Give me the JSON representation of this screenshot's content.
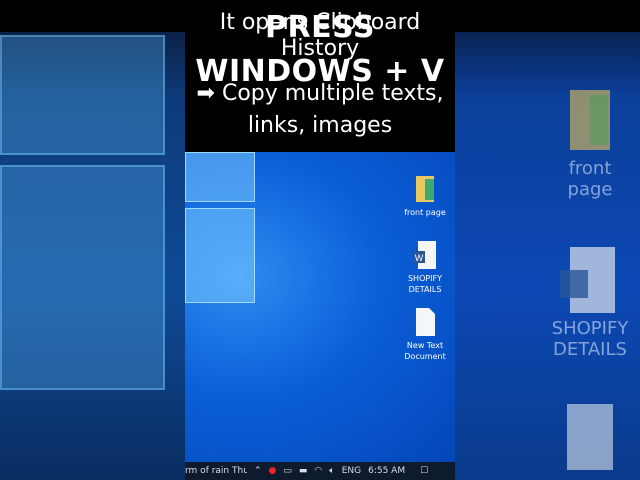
{
  "caption": {
    "headline": "PRESS WINDOWS + V",
    "subtitle": "It opens Clipboard History",
    "bullet_arrow": "➡",
    "bullet": "Copy multiple texts, links, images"
  },
  "desktop": {
    "icons": [
      {
        "label": "front page",
        "icon": "folder-icon"
      },
      {
        "label": "SHOPIFY DETAILS",
        "icon": "word-document-icon"
      },
      {
        "label": "New Text Document",
        "icon": "text-document-icon"
      }
    ]
  },
  "taskbar": {
    "weather": "rm of rain Thu",
    "language": "ENG",
    "time": "6:55 AM"
  },
  "colors": {
    "desktop": "#0b5fd8",
    "caption_bg": "#000000"
  }
}
